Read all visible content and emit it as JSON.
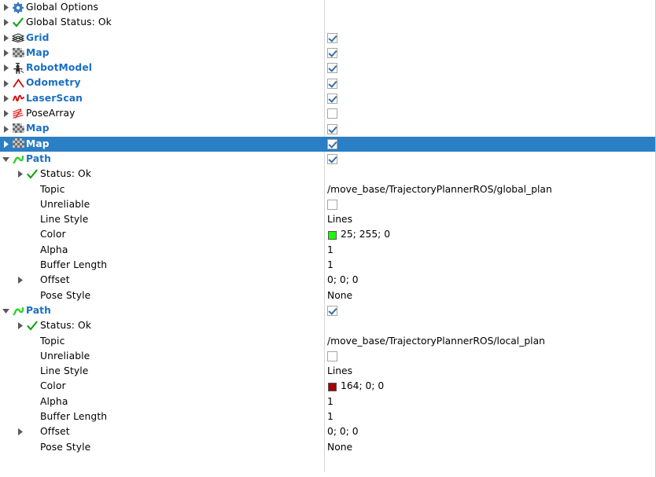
{
  "panel": {
    "name": "rviz-displays-tree",
    "selection_color": "#2b7fc4",
    "enabled_label_color": "#1a6fc4"
  },
  "rows": [
    {
      "label": "Global Options",
      "icon": "gear-icon",
      "arrow": "collapsed",
      "indent": 0,
      "style": "plain",
      "value_type": "none"
    },
    {
      "label": "Global Status: Ok",
      "icon": "check-ok-icon",
      "arrow": "collapsed",
      "indent": 0,
      "style": "plain",
      "value_type": "none"
    },
    {
      "label": "Grid",
      "icon": "grid-display-icon",
      "arrow": "collapsed",
      "indent": 0,
      "style": "display",
      "value_type": "checkbox",
      "checked": true
    },
    {
      "label": "Map",
      "icon": "map-display-icon",
      "arrow": "collapsed",
      "indent": 0,
      "style": "display",
      "value_type": "checkbox",
      "checked": true
    },
    {
      "label": "RobotModel",
      "icon": "robotmodel-display-icon",
      "arrow": "collapsed",
      "indent": 0,
      "style": "display",
      "value_type": "checkbox",
      "checked": true
    },
    {
      "label": "Odometry",
      "icon": "odometry-display-icon",
      "arrow": "collapsed",
      "indent": 0,
      "style": "display",
      "value_type": "checkbox",
      "checked": true
    },
    {
      "label": "LaserScan",
      "icon": "laserscan-display-icon",
      "arrow": "collapsed",
      "indent": 0,
      "style": "display",
      "value_type": "checkbox",
      "checked": true
    },
    {
      "label": "PoseArray",
      "icon": "posearray-display-icon",
      "arrow": "collapsed",
      "indent": 0,
      "style": "plain",
      "value_type": "checkbox",
      "checked": false
    },
    {
      "label": "Map",
      "icon": "map-display-icon",
      "arrow": "collapsed",
      "indent": 0,
      "style": "display",
      "value_type": "checkbox",
      "checked": true
    },
    {
      "label": "Map",
      "icon": "map-display-icon",
      "arrow": "collapsed",
      "indent": 0,
      "style": "display",
      "value_type": "checkbox",
      "checked": true,
      "selected": true
    },
    {
      "label": "Path",
      "icon": "path-display-icon",
      "arrow": "expanded",
      "indent": 0,
      "style": "display",
      "value_type": "checkbox",
      "checked": true
    },
    {
      "label": "Status: Ok",
      "icon": "check-ok-icon",
      "arrow": "collapsed",
      "indent": 1,
      "style": "plain",
      "value_type": "none"
    },
    {
      "label": "Topic",
      "icon": "none",
      "arrow": "none",
      "indent": 1,
      "style": "plain",
      "value_type": "text",
      "value": "/move_base/TrajectoryPlannerROS/global_plan"
    },
    {
      "label": "Unreliable",
      "icon": "none",
      "arrow": "none",
      "indent": 1,
      "style": "plain",
      "value_type": "checkbox",
      "checked": false
    },
    {
      "label": "Line Style",
      "icon": "none",
      "arrow": "none",
      "indent": 1,
      "style": "plain",
      "value_type": "text",
      "value": "Lines"
    },
    {
      "label": "Color",
      "icon": "none",
      "arrow": "none",
      "indent": 1,
      "style": "plain",
      "value_type": "color",
      "value": "25; 255; 0",
      "swatch": "#19ff00"
    },
    {
      "label": "Alpha",
      "icon": "none",
      "arrow": "none",
      "indent": 1,
      "style": "plain",
      "value_type": "text",
      "value": "1"
    },
    {
      "label": "Buffer Length",
      "icon": "none",
      "arrow": "none",
      "indent": 1,
      "style": "plain",
      "value_type": "text",
      "value": "1"
    },
    {
      "label": "Offset",
      "icon": "none",
      "arrow": "collapsed",
      "indent": 1,
      "style": "plain",
      "value_type": "text",
      "value": "0; 0; 0"
    },
    {
      "label": "Pose Style",
      "icon": "none",
      "arrow": "none",
      "indent": 1,
      "style": "plain",
      "value_type": "text",
      "value": "None"
    },
    {
      "label": "Path",
      "icon": "path-display-icon",
      "arrow": "expanded",
      "indent": 0,
      "style": "display",
      "value_type": "checkbox",
      "checked": true
    },
    {
      "label": "Status: Ok",
      "icon": "check-ok-icon",
      "arrow": "collapsed",
      "indent": 1,
      "style": "plain",
      "value_type": "none"
    },
    {
      "label": "Topic",
      "icon": "none",
      "arrow": "none",
      "indent": 1,
      "style": "plain",
      "value_type": "text",
      "value": "/move_base/TrajectoryPlannerROS/local_plan"
    },
    {
      "label": "Unreliable",
      "icon": "none",
      "arrow": "none",
      "indent": 1,
      "style": "plain",
      "value_type": "checkbox",
      "checked": false
    },
    {
      "label": "Line Style",
      "icon": "none",
      "arrow": "none",
      "indent": 1,
      "style": "plain",
      "value_type": "text",
      "value": "Lines"
    },
    {
      "label": "Color",
      "icon": "none",
      "arrow": "none",
      "indent": 1,
      "style": "plain",
      "value_type": "color",
      "value": "164; 0; 0",
      "swatch": "#a40000"
    },
    {
      "label": "Alpha",
      "icon": "none",
      "arrow": "none",
      "indent": 1,
      "style": "plain",
      "value_type": "text",
      "value": "1"
    },
    {
      "label": "Buffer Length",
      "icon": "none",
      "arrow": "none",
      "indent": 1,
      "style": "plain",
      "value_type": "text",
      "value": "1"
    },
    {
      "label": "Offset",
      "icon": "none",
      "arrow": "collapsed",
      "indent": 1,
      "style": "plain",
      "value_type": "text",
      "value": "0; 0; 0"
    },
    {
      "label": "Pose Style",
      "icon": "none",
      "arrow": "none",
      "indent": 1,
      "style": "plain",
      "value_type": "text",
      "value": "None"
    }
  ]
}
